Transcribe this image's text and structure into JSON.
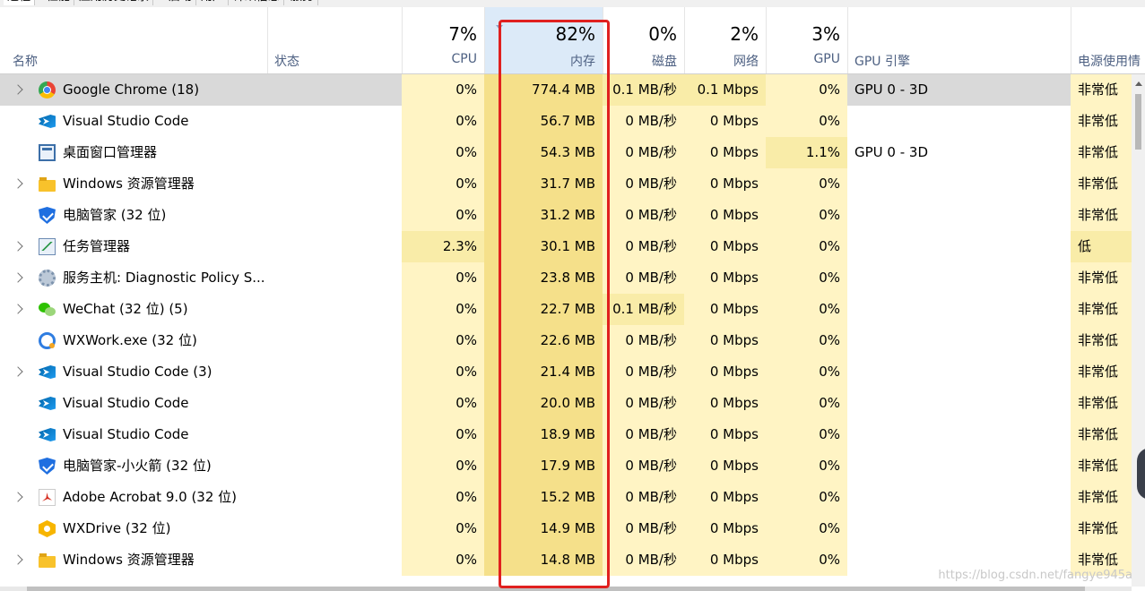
{
  "tabs": [
    {
      "label": "进程",
      "active": true
    },
    {
      "label": "性能",
      "active": false
    },
    {
      "label": "应用历史记录",
      "active": false
    },
    {
      "label": "启动",
      "active": false
    },
    {
      "label": "用户",
      "active": false
    },
    {
      "label": "详细信息",
      "active": false
    },
    {
      "label": "服务",
      "active": false
    }
  ],
  "edge_mark": "\\",
  "header": {
    "name": "名称",
    "status": "状态",
    "cpu_pct": "7%",
    "cpu": "CPU",
    "memory_pct": "82%",
    "memory": "内存",
    "disk_pct": "0%",
    "disk": "磁盘",
    "network_pct": "2%",
    "network": "网络",
    "gpu_pct": "3%",
    "gpu": "GPU",
    "gpu_engine": "GPU 引擎",
    "power": "电源使用情"
  },
  "rows": [
    {
      "icon": "chrome-icon",
      "expandable": true,
      "selected": true,
      "name": "Google Chrome (18)",
      "cpu": "0%",
      "memory": "774.4 MB",
      "disk": "0.1 MB/秒",
      "network": "0.1 Mbps",
      "gpu": "0%",
      "gpu_engine": "GPU 0 - 3D",
      "power": "非常低"
    },
    {
      "icon": "vscode-icon",
      "expandable": false,
      "selected": false,
      "name": "Visual Studio Code",
      "cpu": "0%",
      "memory": "56.7 MB",
      "disk": "0 MB/秒",
      "network": "0 Mbps",
      "gpu": "0%",
      "gpu_engine": "",
      "power": "非常低"
    },
    {
      "icon": "desktop-window-manager-icon",
      "expandable": false,
      "selected": false,
      "name": "桌面窗口管理器",
      "cpu": "0%",
      "memory": "54.3 MB",
      "disk": "0 MB/秒",
      "network": "0 Mbps",
      "gpu": "1.1%",
      "gpu_engine": "GPU 0 - 3D",
      "power": "非常低"
    },
    {
      "icon": "folder-icon",
      "expandable": true,
      "selected": false,
      "name": "Windows 资源管理器",
      "cpu": "0%",
      "memory": "31.7 MB",
      "disk": "0 MB/秒",
      "network": "0 Mbps",
      "gpu": "0%",
      "gpu_engine": "",
      "power": "非常低"
    },
    {
      "icon": "shield-icon",
      "expandable": false,
      "selected": false,
      "name": "电脑管家 (32 位)",
      "cpu": "0%",
      "memory": "31.2 MB",
      "disk": "0 MB/秒",
      "network": "0 Mbps",
      "gpu": "0%",
      "gpu_engine": "",
      "power": "非常低"
    },
    {
      "icon": "task-manager-icon",
      "expandable": true,
      "selected": false,
      "name": "任务管理器",
      "cpu": "2.3%",
      "memory": "30.1 MB",
      "disk": "0 MB/秒",
      "network": "0 Mbps",
      "gpu": "0%",
      "gpu_engine": "",
      "power": "低"
    },
    {
      "icon": "gear-icon",
      "expandable": true,
      "selected": false,
      "name": "服务主机: Diagnostic Policy S...",
      "cpu": "0%",
      "memory": "23.8 MB",
      "disk": "0 MB/秒",
      "network": "0 Mbps",
      "gpu": "0%",
      "gpu_engine": "",
      "power": "非常低"
    },
    {
      "icon": "wechat-icon",
      "expandable": true,
      "selected": false,
      "name": "WeChat (32 位) (5)",
      "cpu": "0%",
      "memory": "22.7 MB",
      "disk": "0.1 MB/秒",
      "network": "0 Mbps",
      "gpu": "0%",
      "gpu_engine": "",
      "power": "非常低"
    },
    {
      "icon": "wxwork-icon",
      "expandable": false,
      "selected": false,
      "name": "WXWork.exe (32 位)",
      "cpu": "0%",
      "memory": "22.6 MB",
      "disk": "0 MB/秒",
      "network": "0 Mbps",
      "gpu": "0%",
      "gpu_engine": "",
      "power": "非常低"
    },
    {
      "icon": "vscode-icon",
      "expandable": true,
      "selected": false,
      "name": "Visual Studio Code (3)",
      "cpu": "0%",
      "memory": "21.4 MB",
      "disk": "0 MB/秒",
      "network": "0 Mbps",
      "gpu": "0%",
      "gpu_engine": "",
      "power": "非常低"
    },
    {
      "icon": "vscode-icon",
      "expandable": false,
      "selected": false,
      "name": "Visual Studio Code",
      "cpu": "0%",
      "memory": "20.0 MB",
      "disk": "0 MB/秒",
      "network": "0 Mbps",
      "gpu": "0%",
      "gpu_engine": "",
      "power": "非常低"
    },
    {
      "icon": "vscode-icon",
      "expandable": false,
      "selected": false,
      "name": "Visual Studio Code",
      "cpu": "0%",
      "memory": "18.9 MB",
      "disk": "0 MB/秒",
      "network": "0 Mbps",
      "gpu": "0%",
      "gpu_engine": "",
      "power": "非常低"
    },
    {
      "icon": "shield-icon",
      "expandable": false,
      "selected": false,
      "name": "电脑管家-小火箭 (32 位)",
      "cpu": "0%",
      "memory": "17.9 MB",
      "disk": "0 MB/秒",
      "network": "0 Mbps",
      "gpu": "0%",
      "gpu_engine": "",
      "power": "非常低"
    },
    {
      "icon": "acrobat-icon",
      "expandable": true,
      "selected": false,
      "name": "Adobe Acrobat 9.0 (32 位)",
      "cpu": "0%",
      "memory": "15.2 MB",
      "disk": "0 MB/秒",
      "network": "0 Mbps",
      "gpu": "0%",
      "gpu_engine": "",
      "power": "非常低"
    },
    {
      "icon": "wxdrive-icon",
      "expandable": false,
      "selected": false,
      "name": "WXDrive (32 位)",
      "cpu": "0%",
      "memory": "14.9 MB",
      "disk": "0 MB/秒",
      "network": "0 Mbps",
      "gpu": "0%",
      "gpu_engine": "",
      "power": "非常低"
    },
    {
      "icon": "folder-icon",
      "expandable": true,
      "selected": false,
      "name": "Windows 资源管理器",
      "cpu": "0%",
      "memory": "14.8 MB",
      "disk": "0 MB/秒",
      "network": "0 Mbps",
      "gpu": "0%",
      "gpu_engine": "",
      "power": "非常低"
    }
  ],
  "watermark": "https://blog.csdn.net/fangye945a",
  "colors": {
    "heat_light": "#fff4c4",
    "heat_mid": "#f9eca8",
    "heat_strong": "#f5e08a",
    "selection": "#d9d9d9",
    "sorted_header": "#dceaf8",
    "annotation_box": "#e0201f"
  }
}
